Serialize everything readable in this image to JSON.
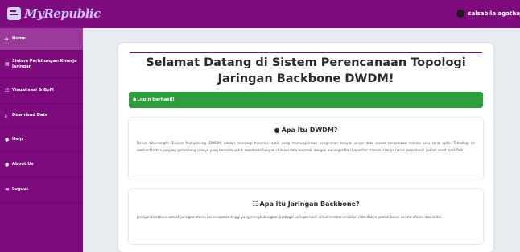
{
  "header": {
    "logo_text": "MyRepublic",
    "user_name": "salsabila agatha"
  },
  "sidebar": {
    "items": [
      {
        "label": "Home",
        "icon": "home-icon",
        "glyph": "⌂"
      },
      {
        "label": "Sistem Perhitungan Kinerja Jaringan",
        "icon": "document-icon",
        "glyph": "▤"
      },
      {
        "label": "Visualisasi & BoM",
        "icon": "network-icon",
        "glyph": "☷"
      },
      {
        "label": "Download Data",
        "icon": "download-icon",
        "glyph": "⤓"
      },
      {
        "label": "Help",
        "icon": "help-icon",
        "glyph": "●"
      },
      {
        "label": "About Us",
        "icon": "info-icon",
        "glyph": "●"
      },
      {
        "label": "Logout",
        "icon": "logout-icon",
        "glyph": "⇥"
      }
    ]
  },
  "main": {
    "title": "Selamat Datang di Sistem Perencanaan Topologi Jaringan Backbone DWDM!",
    "alert": "Login berhasil!",
    "sections": [
      {
        "title": "Apa itu DWDM?",
        "icon": "lightbulb-icon",
        "body": "Dense Wavelength Division Multiplexing (DWDM) adalah teknologi transmisi optik yang memungkinkan pengiriman banyak sinyal data secara bersamaan melalui satu serat optik. Teknologi ini memanfaatkan panjang gelombang cahaya yang berbeda untuk membawa banyak channel data terpisah, dengan meningkatkan kapasitas transmisi tanpa harus menambah jumlah serat optik fisik."
      },
      {
        "title": "Apa itu Jaringan Backbone?",
        "icon": "sitemap-icon",
        "body": "Jaringan backbone adalah jaringan utama berkecepatan tinggi yang menghubungkan berbagai jaringan lokal untuk mentransmisikan data dalam jumlah besar secara efisien dan andal."
      }
    ]
  },
  "colors": {
    "brand": "#7e0b7e",
    "sidebar_active": "#9b3a9b",
    "alert_success": "#2e9e3e",
    "logo_text": "#c9c3ff"
  }
}
